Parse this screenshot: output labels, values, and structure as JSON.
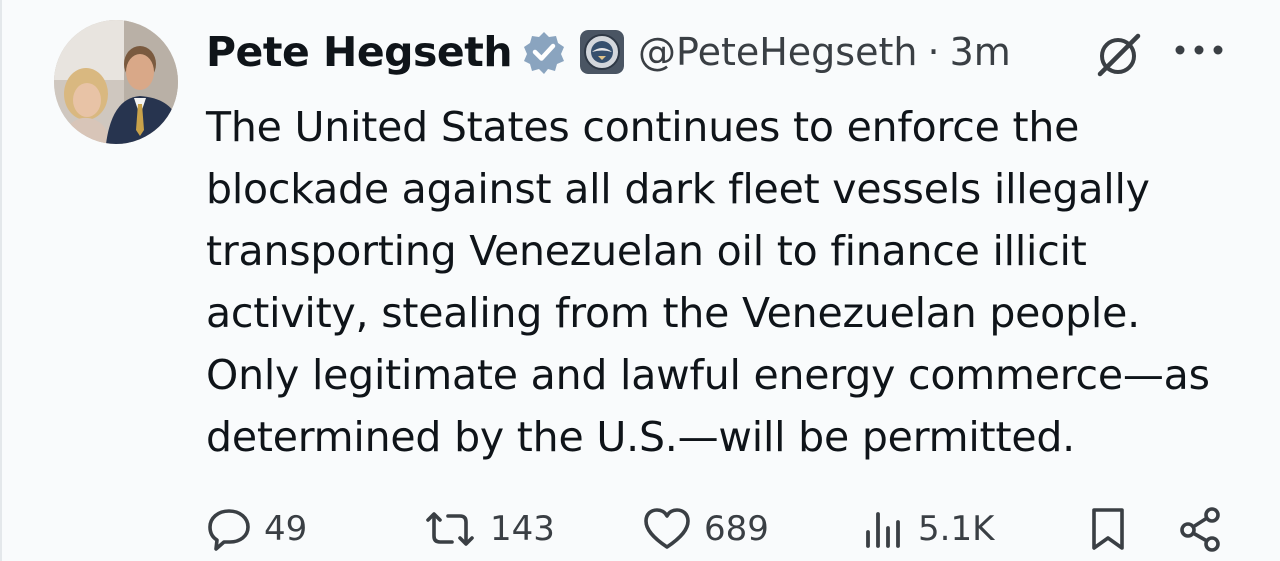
{
  "author": {
    "name": "Pete Hegseth",
    "handle": "@PeteHegseth",
    "separator": "·",
    "time": "3m"
  },
  "tweet": {
    "text": "The United States continues to enforce the\nblockade against all dark fleet vessels illegally\ntransporting Venezuelan oil to finance illicit\nactivity, stealing from the Venezuelan people.\nOnly legitimate and lawful energy commerce—as\ndetermined by the U.S.—will be permitted."
  },
  "actions": {
    "replies": "49",
    "reposts": "143",
    "likes": "689",
    "views": "5.1K"
  },
  "icons": {
    "verified": "verified-badge-icon",
    "affiliation": "department-seal-icon",
    "grok": "grok-icon",
    "more": "more-icon",
    "reply": "reply-icon",
    "repost": "repost-icon",
    "like": "heart-icon",
    "views": "views-icon",
    "bookmark": "bookmark-icon",
    "share": "share-icon"
  },
  "colors": {
    "text": "#0f1419",
    "secondary": "#3a3f44",
    "verified_badge": "#8aa4bf",
    "background": "#f9fbfc"
  }
}
